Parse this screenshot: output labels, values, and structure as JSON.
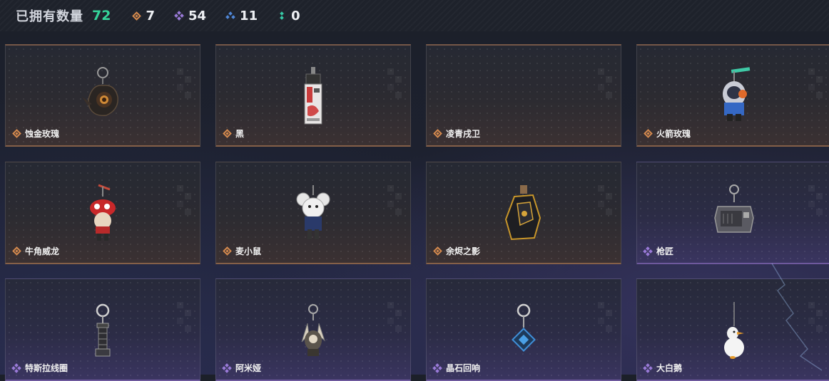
{
  "header": {
    "title": "已拥有数量",
    "total": "72",
    "stats": [
      {
        "icon": "gold-rarity-icon",
        "value": "7"
      },
      {
        "icon": "purple-rarity-icon",
        "value": "54"
      },
      {
        "icon": "blue-rarity-icon",
        "value": "11"
      },
      {
        "icon": "green-rarity-icon",
        "value": "0"
      }
    ]
  },
  "colors": {
    "gold": "#d58a4e",
    "purple": "#9a7ad8",
    "blue": "#4f86d6",
    "green": "#37c9a6",
    "total": "#35d39a"
  },
  "items": [
    {
      "name": "蚀金玫瑰",
      "rarity": "gold",
      "icon": "rose-charm-icon"
    },
    {
      "name": "黑",
      "rarity": "gold",
      "icon": "tag-charm-icon"
    },
    {
      "name": "凌青戌卫",
      "rarity": "gold",
      "icon": "empty-charm-icon"
    },
    {
      "name": "火箭玫瑰",
      "rarity": "gold",
      "icon": "rocket-charm-icon"
    },
    {
      "name": "牛角威龙",
      "rarity": "gold",
      "icon": "dragon-charm-icon"
    },
    {
      "name": "麦小鼠",
      "rarity": "gold",
      "icon": "mouse-charm-icon"
    },
    {
      "name": "余烬之影",
      "rarity": "gold",
      "icon": "shadow-charm-icon"
    },
    {
      "name": "枪匠",
      "rarity": "purple",
      "icon": "gunsmith-charm-icon"
    },
    {
      "name": "特斯拉线圈",
      "rarity": "purple",
      "icon": "tesla-coil-charm-icon"
    },
    {
      "name": "阿米娅",
      "rarity": "purple",
      "icon": "amiya-charm-icon"
    },
    {
      "name": "晶石回响",
      "rarity": "purple",
      "icon": "crystal-charm-icon"
    },
    {
      "name": "大白鹅",
      "rarity": "purple",
      "icon": "goose-charm-icon"
    }
  ]
}
